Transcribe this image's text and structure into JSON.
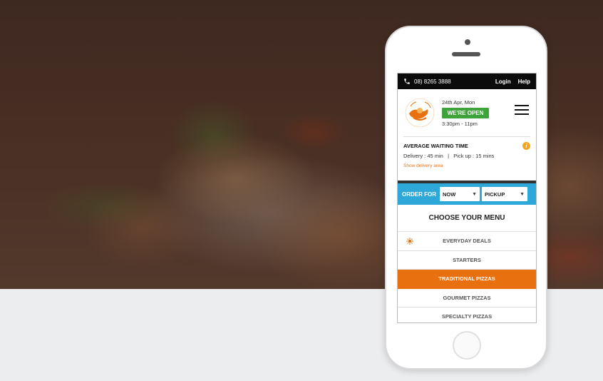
{
  "topbar": {
    "phone": "08) 8265 3888",
    "login": "Login",
    "help": "Help"
  },
  "header": {
    "logo_icon": "mr-pizza-logo",
    "date": "24th Apr, Mon",
    "status": "WE'RE OPEN",
    "hours": "3:30pm - 11pm",
    "menu_icon": "hamburger-icon"
  },
  "waiting": {
    "title": "AVERAGE WAITING TIME",
    "times": "Delivery : 45 min   |   Pick up : 15 mins",
    "show_area": "Show delivery area",
    "info_icon": "i"
  },
  "order": {
    "label": "ORDER FOR",
    "time_value": "NOW",
    "type_value": "PICKUP"
  },
  "menu": {
    "title": "CHOOSE YOUR MENU",
    "items": [
      {
        "label": "EVERYDAY DEALS"
      },
      {
        "label": "STARTERS"
      },
      {
        "label": "TRADITIONAL PIZZAS"
      },
      {
        "label": "GOURMET PIZZAS"
      },
      {
        "label": "SPECIALTY PIZZAS"
      }
    ]
  },
  "colors": {
    "accent_orange": "#e8700f",
    "open_green": "#3ea33a",
    "order_blue": "#2ea7d9"
  }
}
